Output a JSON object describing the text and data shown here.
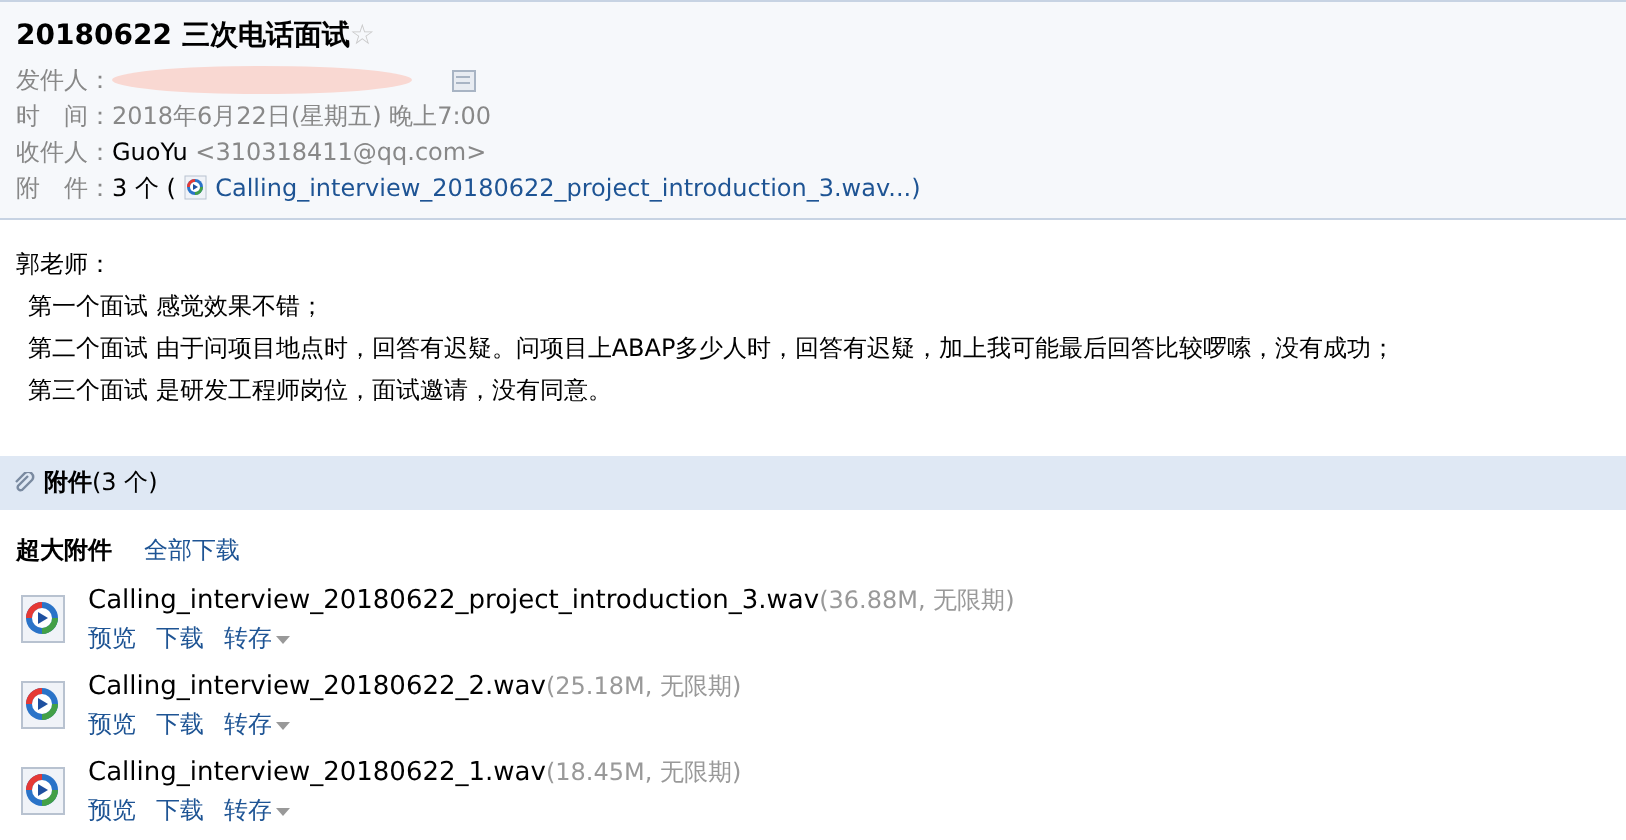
{
  "subject": {
    "title": "20180622 三次电话面试",
    "starred": false,
    "star": "☆"
  },
  "header_fields": [
    {
      "kind": "sender",
      "label": "发件人："
    },
    {
      "kind": "text",
      "label": "时　间：",
      "value": "2018年6月22日(星期五) 晚上7:00"
    },
    {
      "kind": "recipient",
      "label": "收件人：",
      "name": "GuoYu",
      "value": "<310318411@qq.com>"
    },
    {
      "kind": "attachment",
      "label": "附　件：",
      "count": "3 个 (",
      "file": "Calling_interview_20180622_project_introduction_3.wav...)"
    }
  ],
  "body": [
    "郭老师：",
    "第一个面试 感觉效果不错；",
    "第二个面试 由于问项目地点时，回答有迟疑。问项目上ABAP多少人时，回答有迟疑，加上我可能最后回答比较啰嗦，没有成功；",
    "第三个面试 是研发工程师岗位，面试邀请，没有同意。"
  ],
  "attachments_bar": {
    "title": "附件",
    "count": "(3 个)"
  },
  "attachments_section": {
    "title": "超大附件",
    "download_all": "全部下载"
  },
  "files": [
    {
      "name": "Calling_interview_20180622_project_introduction_3.wav",
      "meta": "(36.88M, 无限期)",
      "actions": [
        "预览",
        "下载",
        "转存"
      ]
    },
    {
      "name": "Calling_interview_20180622_2.wav",
      "meta": "(25.18M, 无限期)",
      "actions": [
        "预览",
        "下载",
        "转存"
      ]
    },
    {
      "name": "Calling_interview_20180622_1.wav",
      "meta": "(18.45M, 无限期)",
      "actions": [
        "预览",
        "下载",
        "转存"
      ]
    }
  ]
}
